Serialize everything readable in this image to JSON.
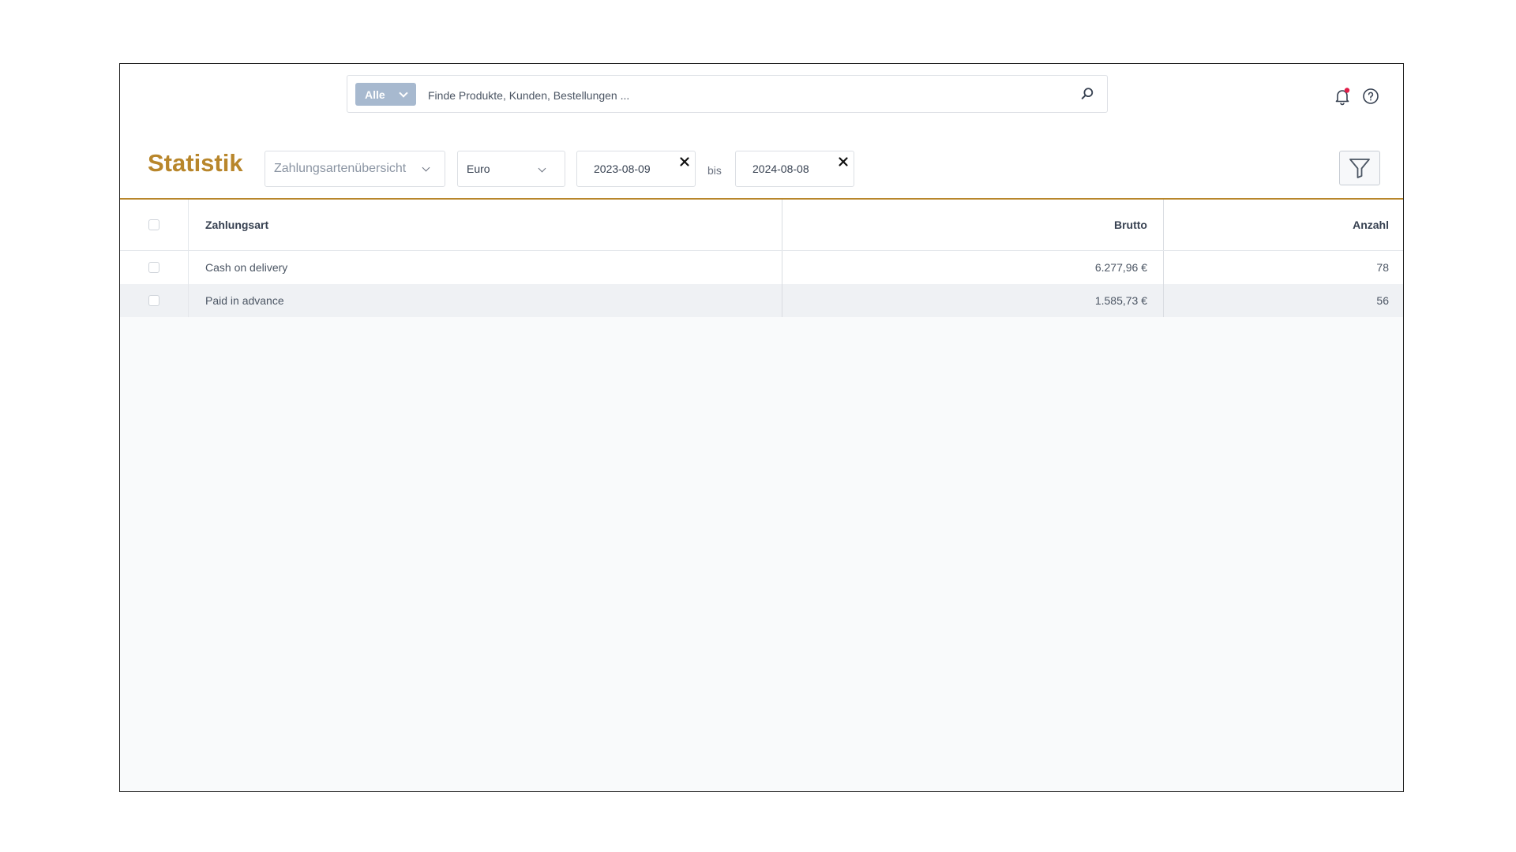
{
  "search": {
    "scope_label": "Alle",
    "placeholder": "Finde Produkte, Kunden, Bestellungen ...",
    "value": ""
  },
  "header_icons": {
    "notifications": "bell-icon",
    "help": "help-icon",
    "notification_dot_color": "#e11d48"
  },
  "toolbar": {
    "title": "Statistik",
    "report_select": "Zahlungsartenübersicht",
    "currency_select": "Euro",
    "date_from": "2023-08-09",
    "range_separator": "bis",
    "date_to": "2024-08-08",
    "filter_icon": "filter-icon"
  },
  "colors": {
    "accent": "#b8862b",
    "scope_badge": "#a7b9cf"
  },
  "table": {
    "columns": [
      "Zahlungsart",
      "Brutto",
      "Anzahl"
    ],
    "rows": [
      {
        "zahlungsart": "Cash on delivery",
        "brutto": "6.277,96 €",
        "anzahl": "78"
      },
      {
        "zahlungsart": "Paid in advance",
        "brutto": "1.585,73 €",
        "anzahl": "56"
      }
    ]
  }
}
